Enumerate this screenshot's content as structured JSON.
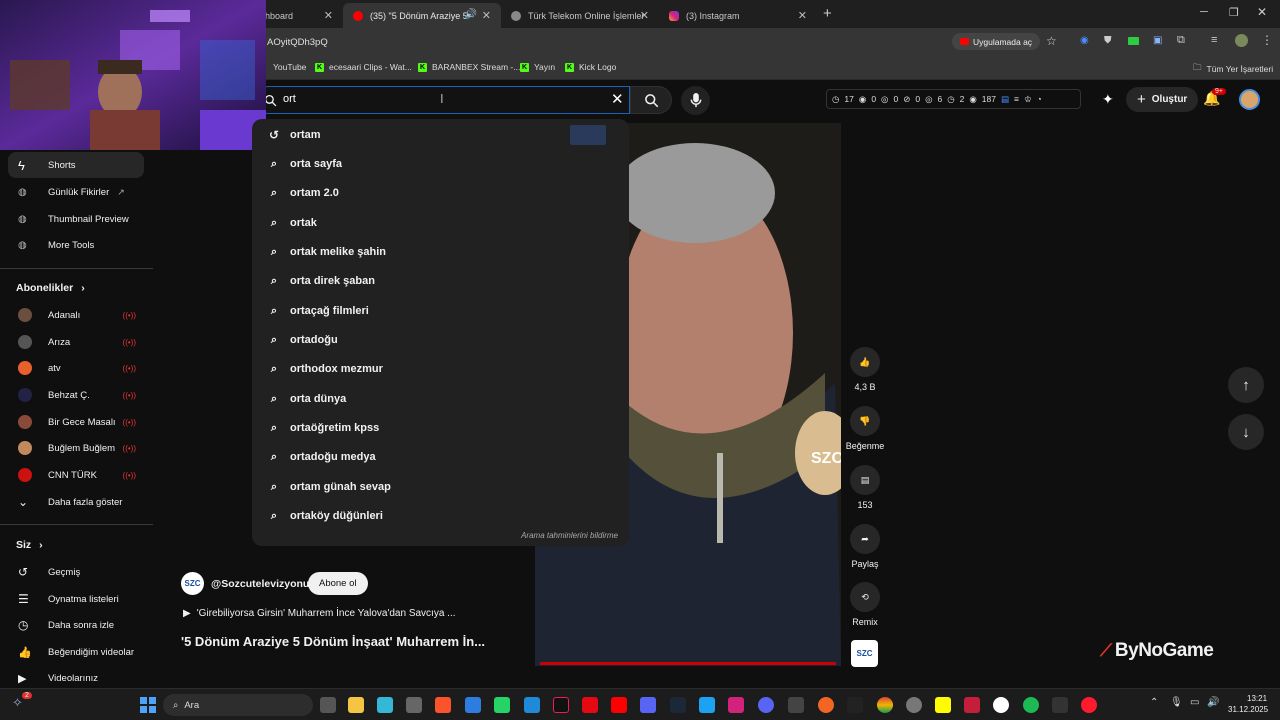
{
  "browser": {
    "tabs": [
      {
        "title": "hboard"
      },
      {
        "title": "(35) \"5 Dönüm Araziye 5 Dö"
      },
      {
        "title": "Türk Telekom Online İşlemler"
      },
      {
        "title": "(3) Instagram"
      }
    ],
    "new_tab": "+",
    "address": "AOyitQDh3pQ",
    "open_in_app": "Uygulamada aç",
    "bookmarks": [
      "YouTube",
      "ecesaari Clips - Wat...",
      "BARANBEX Stream -...",
      "Yayın",
      "Kick Logo"
    ],
    "all_bookmarks": "Tüm Yer İşaretleri"
  },
  "search": {
    "query": "ort",
    "suggestions": [
      {
        "text": "ortam",
        "icon": "history-icon"
      },
      {
        "text": "orta sayfa",
        "icon": "search-icon"
      },
      {
        "text": "ortam 2.0",
        "icon": "search-icon"
      },
      {
        "text": "ortak",
        "icon": "search-icon"
      },
      {
        "text": "ortak melike şahin",
        "icon": "search-icon"
      },
      {
        "text": "orta direk şaban",
        "icon": "search-icon"
      },
      {
        "text": "ortaçağ filmleri",
        "icon": "search-icon"
      },
      {
        "text": "ortadoğu",
        "icon": "search-icon"
      },
      {
        "text": "orthodox mezmur",
        "icon": "search-icon"
      },
      {
        "text": "orta dünya",
        "icon": "search-icon"
      },
      {
        "text": "ortaöğretim kpss",
        "icon": "search-icon"
      },
      {
        "text": "ortadoğu medya",
        "icon": "search-icon"
      },
      {
        "text": "ortam günah sevap",
        "icon": "search-icon"
      },
      {
        "text": "ortaköy düğünleri",
        "icon": "search-icon"
      }
    ],
    "report": "Arama tahminlerini bildirme"
  },
  "extension_stats": {
    "a": "17",
    "b": "0",
    "c": "0",
    "d": "0",
    "e": "6",
    "f": "2",
    "g": "187"
  },
  "header": {
    "create_label": "Oluştur",
    "notif_badge": "9+"
  },
  "sidebar": {
    "top": [
      {
        "label": "Shorts"
      },
      {
        "label": "Günlük Fikirler"
      },
      {
        "label": "Thumbnail Preview"
      },
      {
        "label": "More Tools"
      }
    ],
    "subs_title": "Abonelikler",
    "subs": [
      {
        "label": "Adanalı",
        "color": "#6b4e3d"
      },
      {
        "label": "Arıza",
        "color": "#555555"
      },
      {
        "label": "atv",
        "color": "#e8612c"
      },
      {
        "label": "Behzat Ç.",
        "color": "#222244"
      },
      {
        "label": "Bir Gece Masalı",
        "color": "#8a4a3a"
      },
      {
        "label": "Buğlem Buğlem",
        "color": "#c28a5a"
      },
      {
        "label": "CNN TÜRK",
        "color": "#cc1111"
      }
    ],
    "show_more": "Daha fazla göster",
    "you_title": "Siz",
    "you": [
      {
        "label": "Geçmiş"
      },
      {
        "label": "Oynatma listeleri"
      },
      {
        "label": "Daha sonra izle"
      },
      {
        "label": "Beğendiğim videolar"
      },
      {
        "label": "Videolarınız"
      }
    ]
  },
  "video": {
    "channel": "@Sozcutelevizyonu",
    "channel_short": "SZC",
    "subscribe": "Abone ol",
    "playlist_line": "'Girebiliyorsa Girsin' Muharrem İnce Yalova'dan Savcıya ...",
    "title": "'5 Dönüm Araziye 5 Dönüm İnşaat' Muharrem İn...",
    "likes": "4,3 B",
    "dislike": "Beğenme",
    "comments": "153",
    "share": "Paylaş",
    "remix": "Remix",
    "mic_logo": "SZC"
  },
  "watermark": "ByNoGame",
  "taskbar": {
    "search": "Ara",
    "time": "13:21",
    "date": "31.12.2025",
    "badge": "2"
  }
}
